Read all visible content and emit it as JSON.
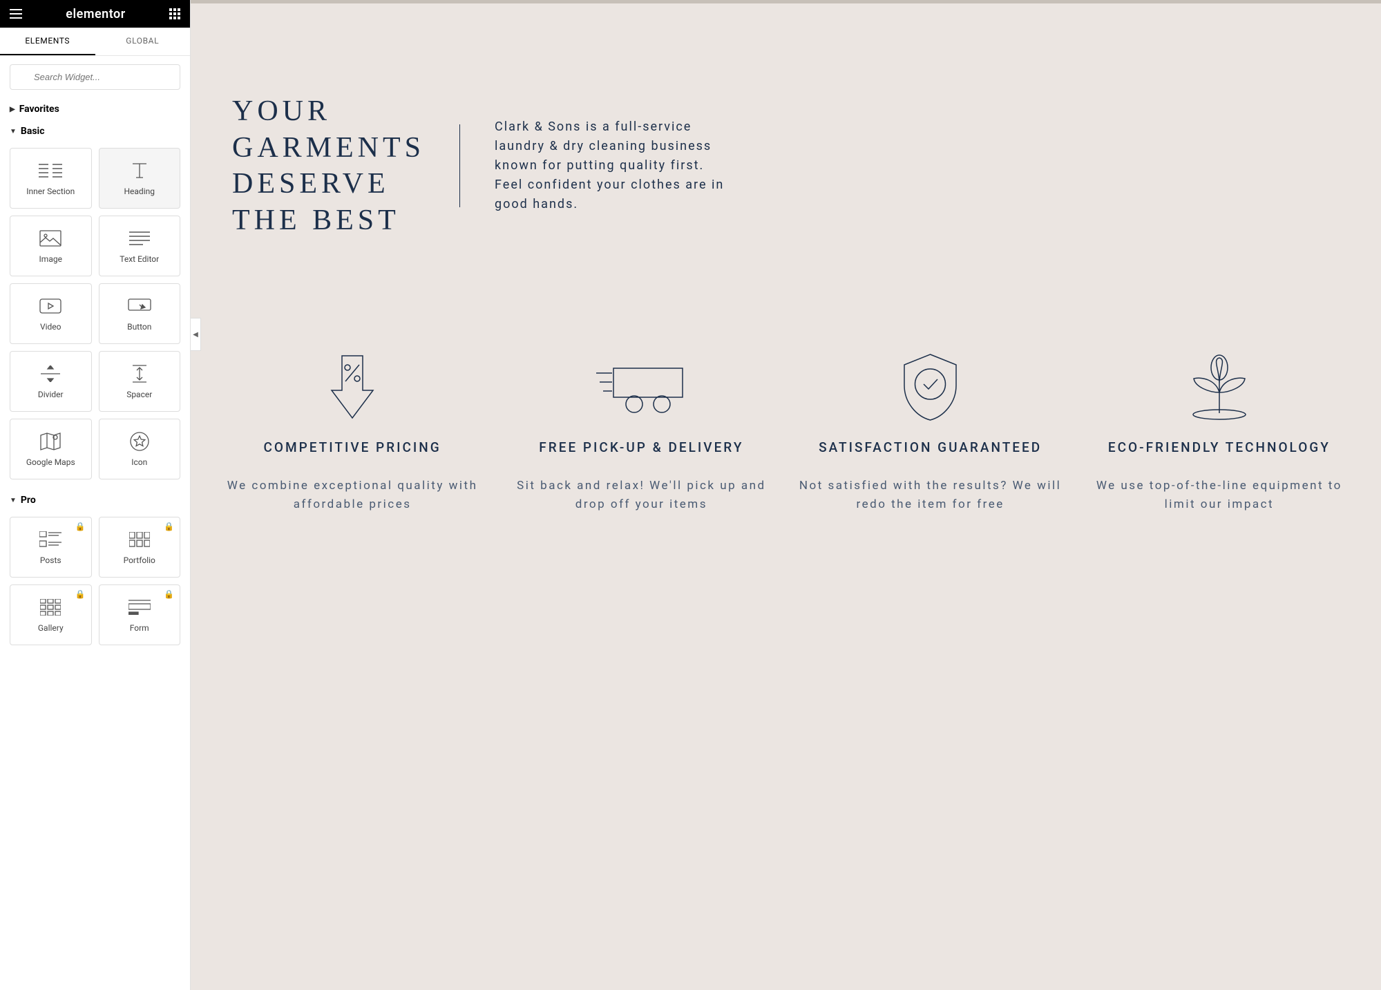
{
  "header": {
    "logo": "elementor"
  },
  "tabs": {
    "elements": "ELEMENTS",
    "global": "GLOBAL"
  },
  "search": {
    "placeholder": "Search Widget..."
  },
  "sections": {
    "favorites": "Favorites",
    "basic": "Basic",
    "pro": "Pro"
  },
  "widgets": {
    "inner_section": "Inner Section",
    "heading": "Heading",
    "image": "Image",
    "text_editor": "Text Editor",
    "video": "Video",
    "button": "Button",
    "divider": "Divider",
    "spacer": "Spacer",
    "google_maps": "Google Maps",
    "icon": "Icon",
    "posts": "Posts",
    "portfolio": "Portfolio",
    "gallery": "Gallery",
    "form": "Form"
  },
  "preview": {
    "hero_title": "YOUR GARMENTS DESERVE THE BEST",
    "hero_text": "Clark & Sons is a full-service laundry & dry cleaning business known for putting quality first. Feel confident your clothes are in good hands.",
    "features": [
      {
        "title": "COMPETITIVE PRICING",
        "text": "We combine exceptional quality with affordable prices"
      },
      {
        "title": "FREE PICK-UP & DELIVERY",
        "text": "Sit back and relax! We'll pick up and drop off your items"
      },
      {
        "title": "SATISFACTION GUARANTEED",
        "text": "Not satisfied with the results? We will redo the item for free"
      },
      {
        "title": "ECO-FRIENDLY TECHNOLOGY",
        "text": "We use top-of-the-line equipment to limit our impact"
      }
    ]
  }
}
